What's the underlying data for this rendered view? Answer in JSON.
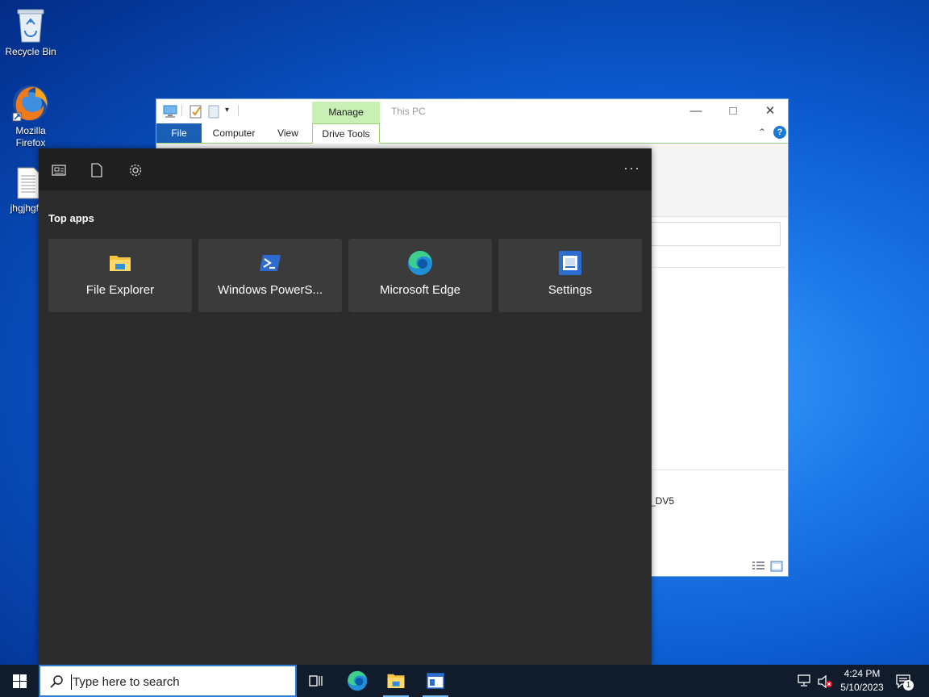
{
  "desktop": {
    "icons": [
      {
        "label": "Recycle Bin"
      },
      {
        "label": "Mozilla Firefox"
      },
      {
        "label": "jhgjhgfjh"
      }
    ]
  },
  "explorer": {
    "title": "This PC",
    "manage_tab": "Manage",
    "tabs": [
      "File",
      "Computer",
      "View",
      "Drive Tools"
    ],
    "drive_label": "_DV5",
    "accent": "#1a5fb4",
    "manage_color": "#c8f0b4"
  },
  "flyout": {
    "section_title": "Top apps",
    "top_icons": [
      "news-icon",
      "document-icon",
      "gear-icon"
    ],
    "more_label": "···",
    "apps": [
      {
        "label": "File Explorer",
        "icon": "folder-icon"
      },
      {
        "label": "Windows PowerS...",
        "icon": "powershell-icon"
      },
      {
        "label": "Microsoft Edge",
        "icon": "edge-icon"
      },
      {
        "label": "Settings",
        "icon": "settings-app-icon"
      }
    ]
  },
  "taskbar": {
    "search_placeholder": "Type here to search",
    "time": "4:24 PM",
    "date": "5/10/2023",
    "notification_count": "1",
    "background": "#101c2c"
  }
}
